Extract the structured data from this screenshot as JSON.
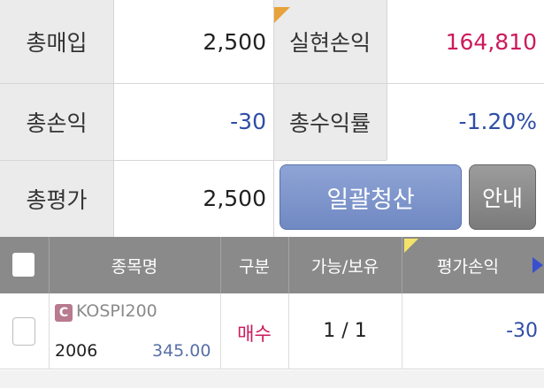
{
  "summary": {
    "total_purchase": {
      "label": "총매입",
      "value": "2,500"
    },
    "realized_pl": {
      "label": "실현손익",
      "value": "164,810"
    },
    "total_pl": {
      "label": "총손익",
      "value": "-30"
    },
    "total_return": {
      "label": "총수익률",
      "value": "-1.20%"
    },
    "total_eval": {
      "label": "총평가",
      "value": "2,500"
    }
  },
  "buttons": {
    "liquidate_all": "일괄청산",
    "guide": "안내"
  },
  "table": {
    "headers": {
      "name": "종목명",
      "type": "구분",
      "avail_hold": "가능/보유",
      "eval_pl": "평가손익"
    },
    "rows": [
      {
        "badge": "C",
        "name": "KOSPI200",
        "code": "2006",
        "price": "345.00",
        "type": "매수",
        "qty": "1 / 1",
        "eval_pl": "-30"
      }
    ]
  },
  "colors": {
    "positive": "#cc1a5c",
    "negative": "#2e4ea6",
    "header_bg": "#8a8a8a",
    "button_primary": "#7c93cc",
    "button_secondary": "#8a8a8a",
    "marker_orange": "#e8a23a",
    "marker_yellow": "#f4e36a"
  }
}
